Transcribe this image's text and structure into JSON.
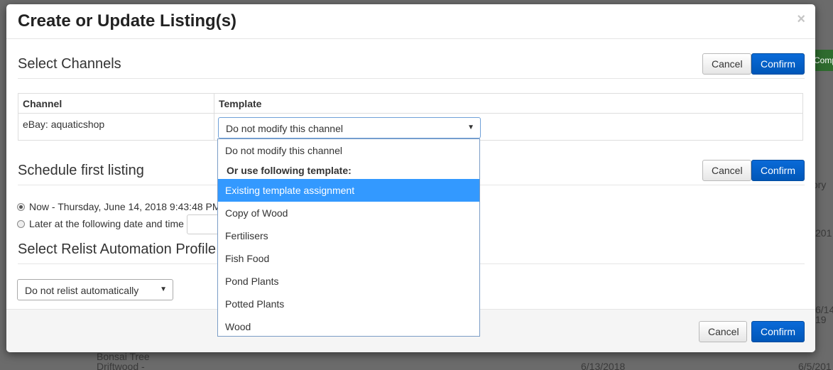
{
  "modal": {
    "title": "Create or Update Listing(s)",
    "close_glyph": "×"
  },
  "channels_section": {
    "title": "Select Channels",
    "cancel_label": "Cancel",
    "confirm_label": "Confirm",
    "table": {
      "headers": [
        "Channel",
        "Template"
      ],
      "rows": [
        {
          "channel": "eBay: aquaticshop",
          "template": "Do not modify this channel"
        }
      ]
    }
  },
  "template_dropdown": {
    "first_option": "Do not modify this channel",
    "group_label": "Or use following template:",
    "options": [
      "Existing template assignment",
      "Copy of Wood",
      "Fertilisers",
      "Fish Food",
      "Pond Plants",
      "Potted Plants",
      "Wood"
    ],
    "selected": "Existing template assignment"
  },
  "schedule_section": {
    "title": "Schedule first listing",
    "cancel_label": "Cancel",
    "confirm_label": "Confirm",
    "option_now": "Now - Thursday, June 14, 2018 9:43:48 PM",
    "option_later": "Later at the following date and time"
  },
  "relist_section": {
    "title": "Select Relist Automation Profile",
    "select_value": "Do not relist automatically"
  },
  "footer": {
    "cancel_label": "Cancel",
    "confirm_label": "Confirm"
  },
  "background": {
    "text_1": "Bonsai Tree",
    "text_2": "Driftwood -",
    "date_1": "6/13/2018",
    "date_2": "6/5/201",
    "date_3": "6/14",
    "date_4": "19",
    "date_5": "201",
    "label_tory": "tory",
    "label_comp": "Comp"
  },
  "colors": {
    "primary_button": "#0057b8",
    "selected_option": "#3399ff",
    "backdrop": "#6b6b6b"
  }
}
